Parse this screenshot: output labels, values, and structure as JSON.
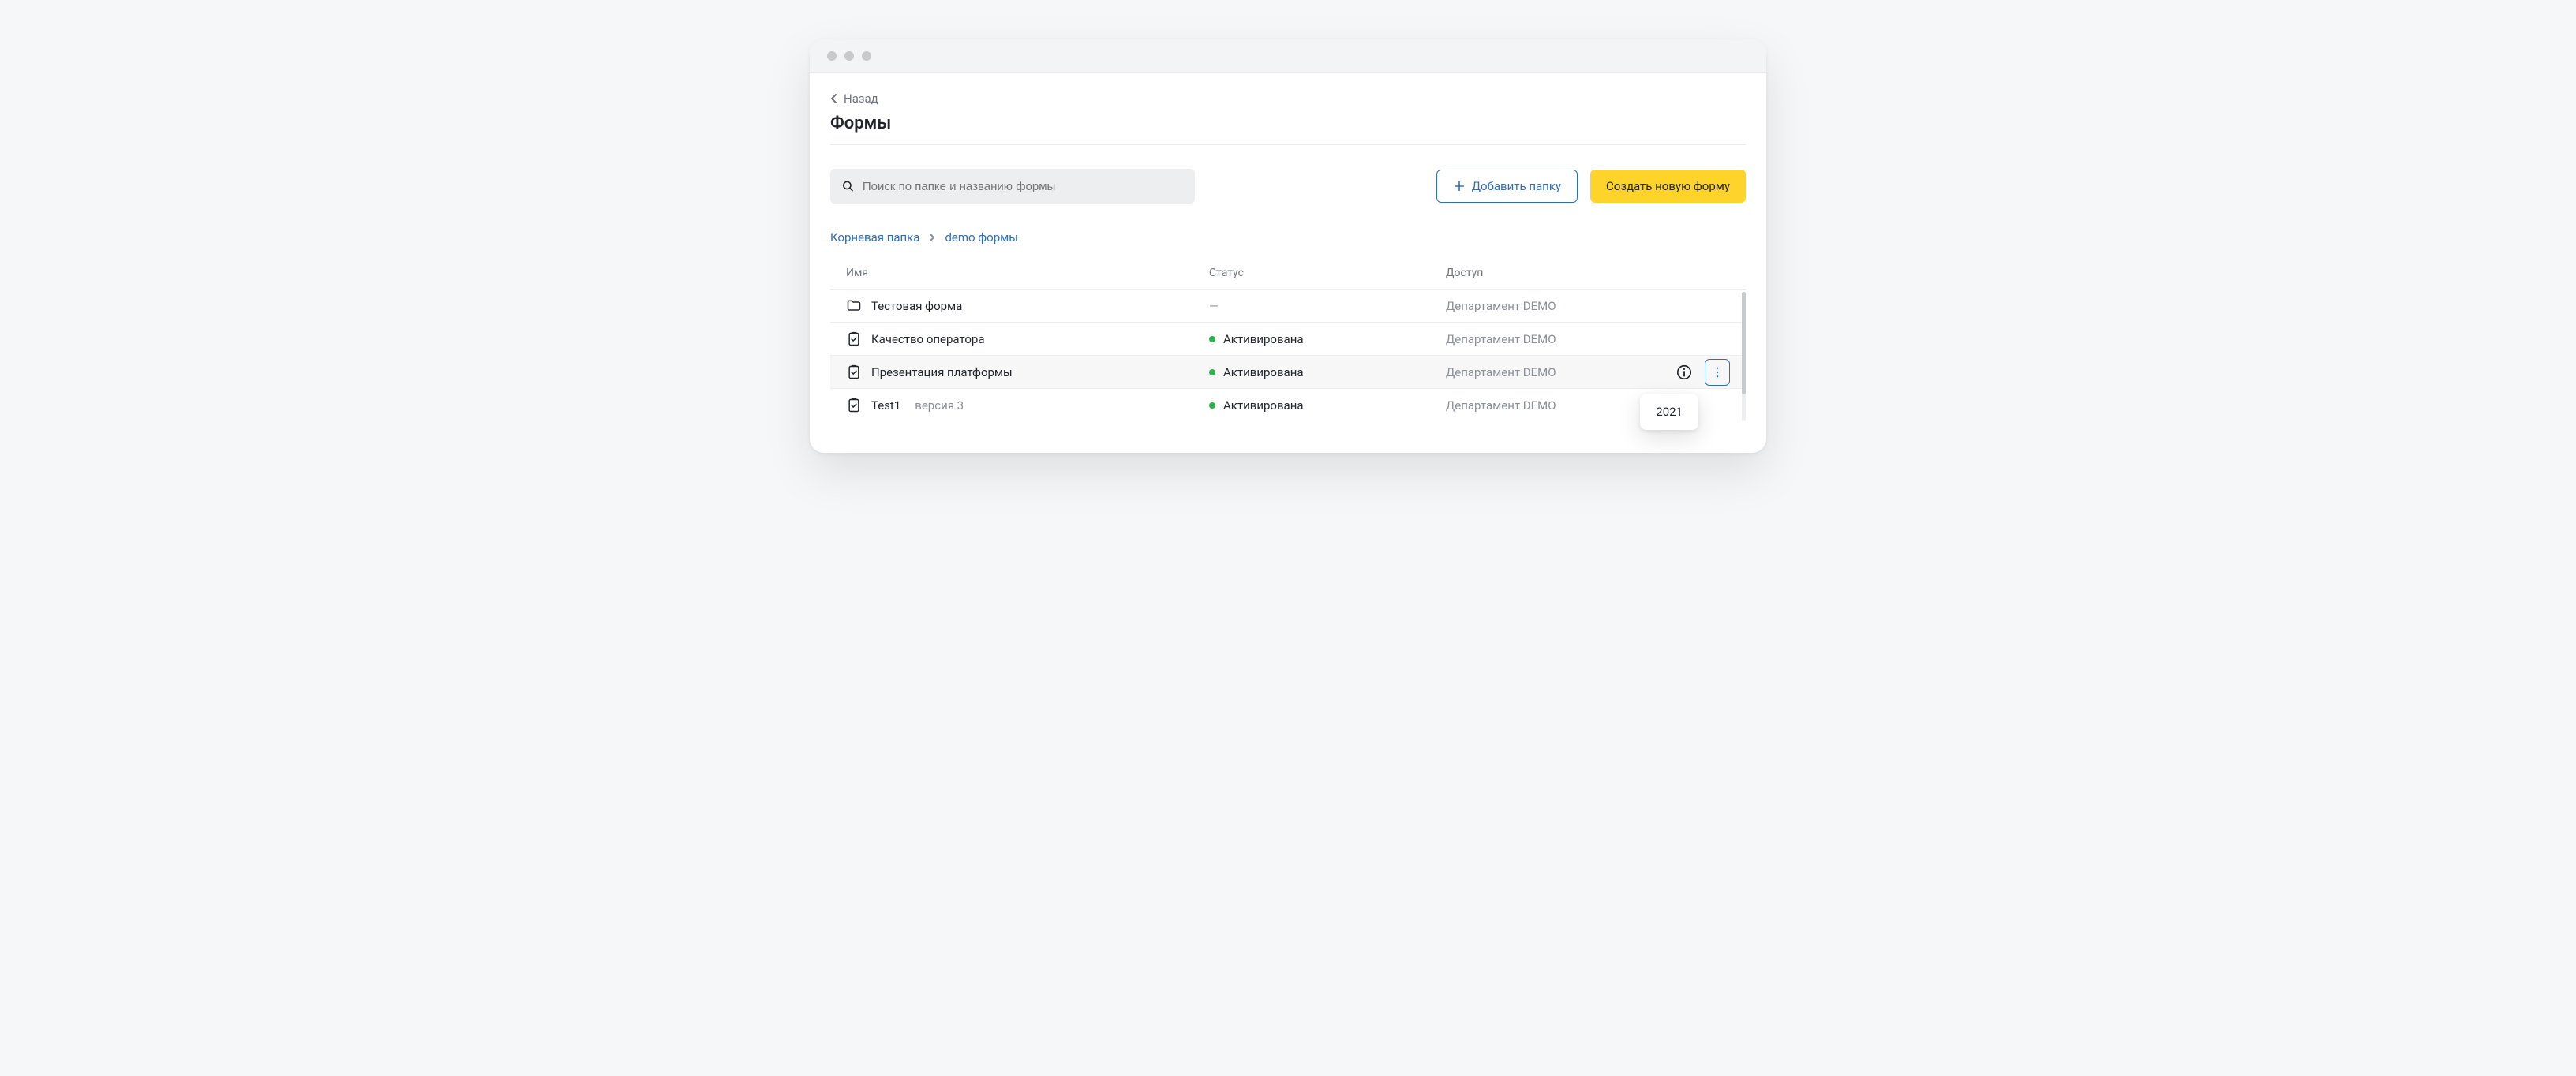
{
  "back_label": "Назад",
  "page_title": "Формы",
  "search": {
    "placeholder": "Поиск по папке и названию формы"
  },
  "buttons": {
    "add_folder": "Добавить папку",
    "create_form": "Создать новую форму"
  },
  "breadcrumbs": {
    "root": "Корневая папка",
    "current": "demo формы"
  },
  "table": {
    "headers": {
      "name": "Имя",
      "status": "Статус",
      "access": "Доступ"
    },
    "rows": [
      {
        "type": "folder",
        "name": "Тестовая форма",
        "status": "—",
        "active": false,
        "access": "Департамент DEMO",
        "hover": false
      },
      {
        "type": "form",
        "name": "Качество оператора",
        "status": "Активирована",
        "active": true,
        "access": "Департамент DEMO",
        "hover": false
      },
      {
        "type": "form",
        "name": "Презентация платформы",
        "status": "Активирована",
        "active": true,
        "access": "Департамент DEMO",
        "hover": true
      },
      {
        "type": "form",
        "name": "Test1",
        "version": "версия 3",
        "status": "Активирована",
        "active": true,
        "access": "Департамент DEMO",
        "hover": false
      }
    ]
  },
  "popover_text": "2021"
}
